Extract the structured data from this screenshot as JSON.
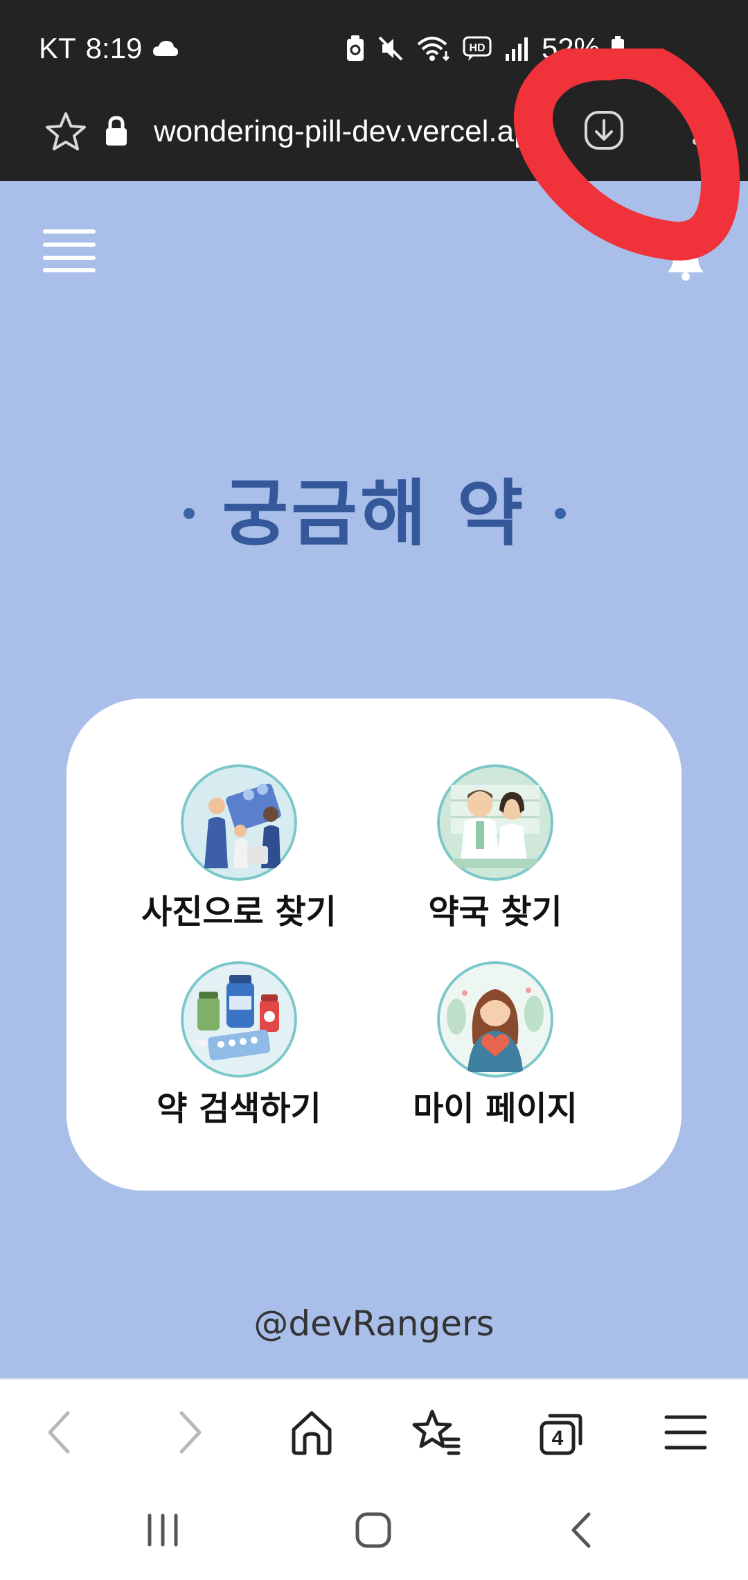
{
  "status_bar": {
    "carrier": "KT",
    "time": "8:19",
    "battery": "52%"
  },
  "address_bar": {
    "url": "wondering-pill-dev.vercel.app"
  },
  "header": {
    "title": "궁금해 약"
  },
  "menu": {
    "items": [
      {
        "label": "사진으로 찾기",
        "icon": "people-photo-illustration-icon"
      },
      {
        "label": "약국 찾기",
        "icon": "pharmacists-illustration-icon"
      },
      {
        "label": "약 검색하기",
        "icon": "medicine-bottles-illustration-icon"
      },
      {
        "label": "마이 페이지",
        "icon": "woman-heart-illustration-icon"
      }
    ]
  },
  "footer": {
    "credit": "@devRangers"
  },
  "colors": {
    "page_background": "#a9bfe9",
    "title": "#34589a",
    "annotation": "#f0323a"
  }
}
